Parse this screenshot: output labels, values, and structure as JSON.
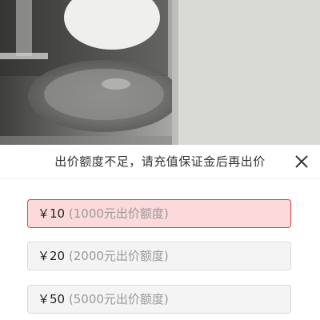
{
  "header": {
    "title": "出价额度不足，请充值保证金后再出价",
    "close_icon": "close-icon"
  },
  "options": [
    {
      "amount": "￥10",
      "note": "(1000元出价额度)",
      "selected": true
    },
    {
      "amount": "￥20",
      "note": "(2000元出价额度)",
      "selected": false
    },
    {
      "amount": "￥50",
      "note": "(5000元出价额度)",
      "selected": false
    }
  ],
  "colors": {
    "selected_bg": "#fcd9db",
    "selected_border": "#e4434b",
    "option_bg": "#f4f4f4",
    "note_text": "#999999"
  }
}
